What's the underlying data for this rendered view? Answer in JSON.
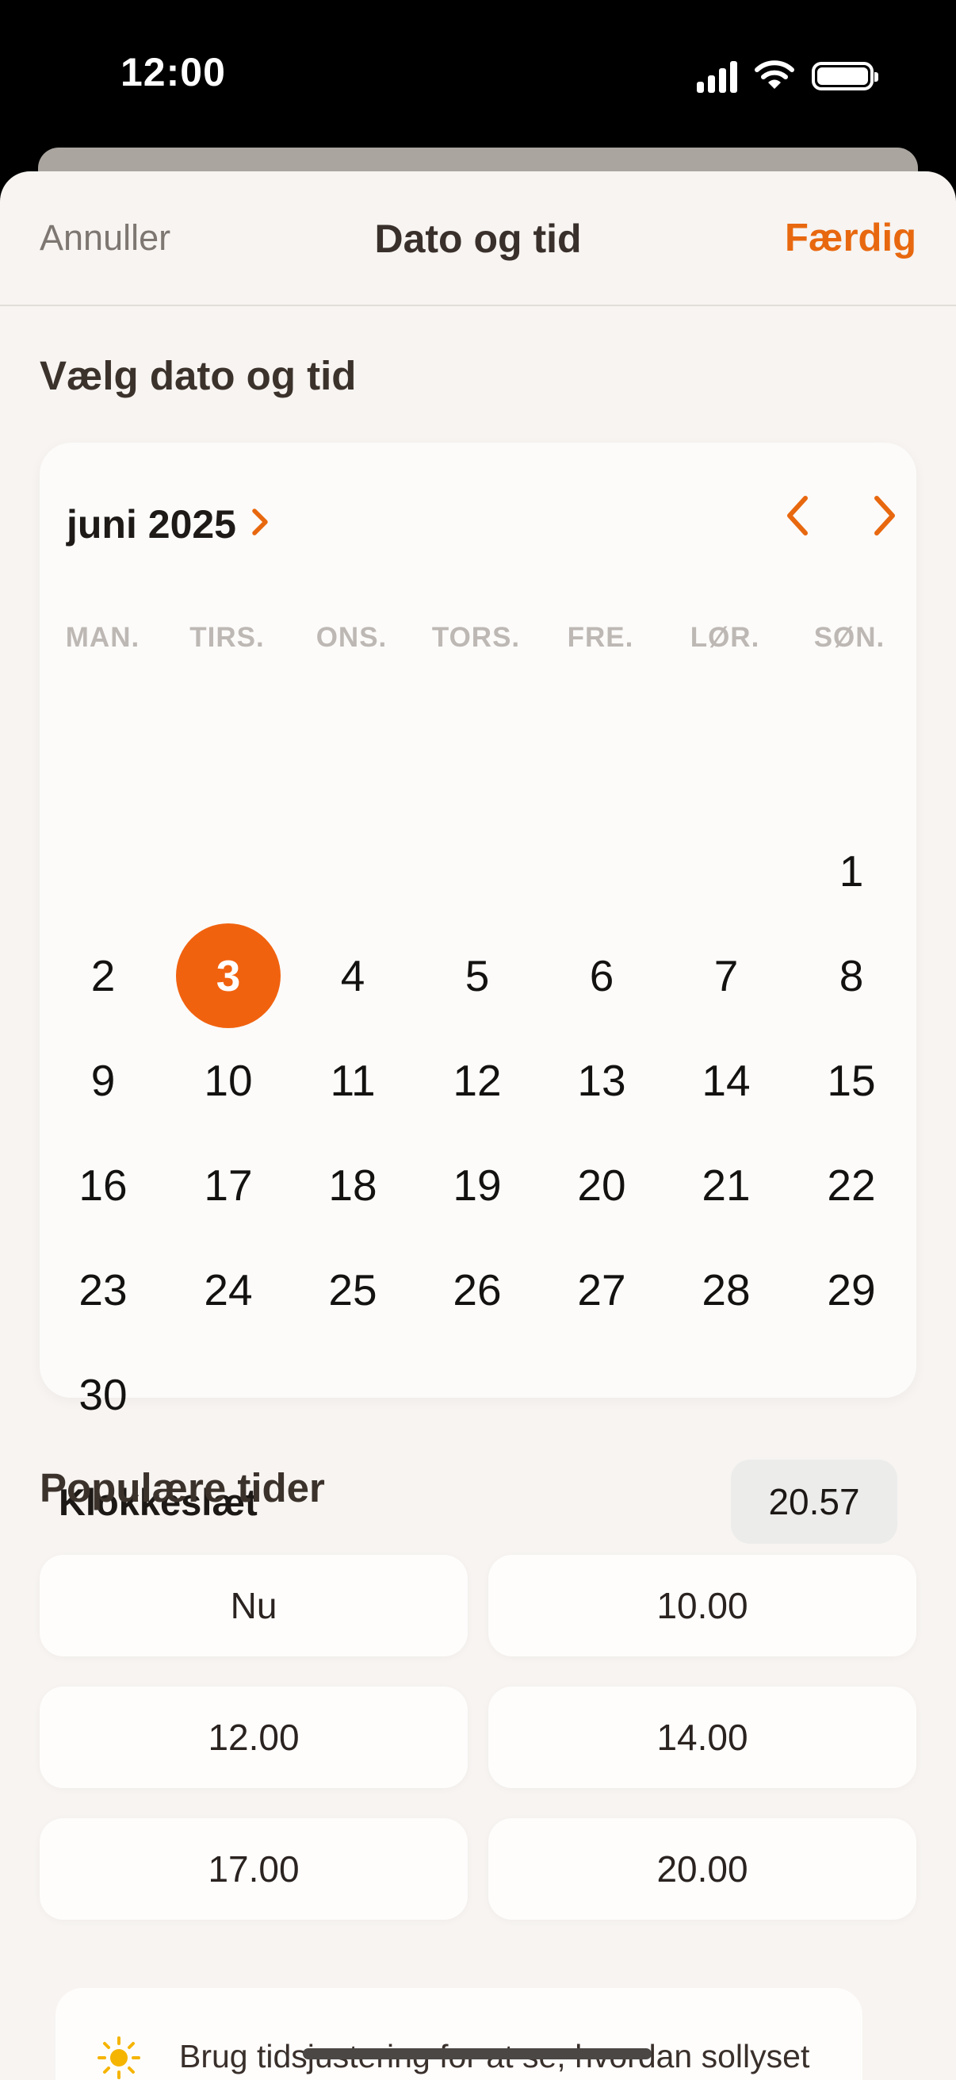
{
  "status_bar": {
    "time": "12:00"
  },
  "nav": {
    "cancel": "Annuller",
    "title": "Dato og tid",
    "done": "Færdig"
  },
  "date_section": {
    "title": "Vælg dato og tid",
    "month_label": "juni 2025",
    "weekdays": [
      "MAN.",
      "TIRS.",
      "ONS.",
      "TORS.",
      "FRE.",
      "LØR.",
      "SØN."
    ],
    "days": [
      "1",
      "2",
      "3",
      "4",
      "5",
      "6",
      "7",
      "8",
      "9",
      "10",
      "11",
      "12",
      "13",
      "14",
      "15",
      "16",
      "17",
      "18",
      "19",
      "20",
      "21",
      "22",
      "23",
      "24",
      "25",
      "26",
      "27",
      "28",
      "29",
      "30"
    ],
    "selected_day": "3",
    "time_label": "Klokkeslæt",
    "time_value": "20.57"
  },
  "popular": {
    "title": "Populære tider",
    "times": [
      "Nu",
      "10.00",
      "12.00",
      "14.00",
      "17.00",
      "20.00"
    ]
  },
  "tip": {
    "text": "Brug tidsjustering for at se, hvordan sollyset bevæger sig i løbet af dagen."
  },
  "colors": {
    "accent": "#f1620f",
    "background": "#f7f4f1",
    "card": "#fcfbfa"
  },
  "icons": [
    "chevron-right-icon",
    "chevron-left-icon",
    "sun-icon",
    "signal-icon",
    "wifi-icon",
    "battery-icon"
  ]
}
